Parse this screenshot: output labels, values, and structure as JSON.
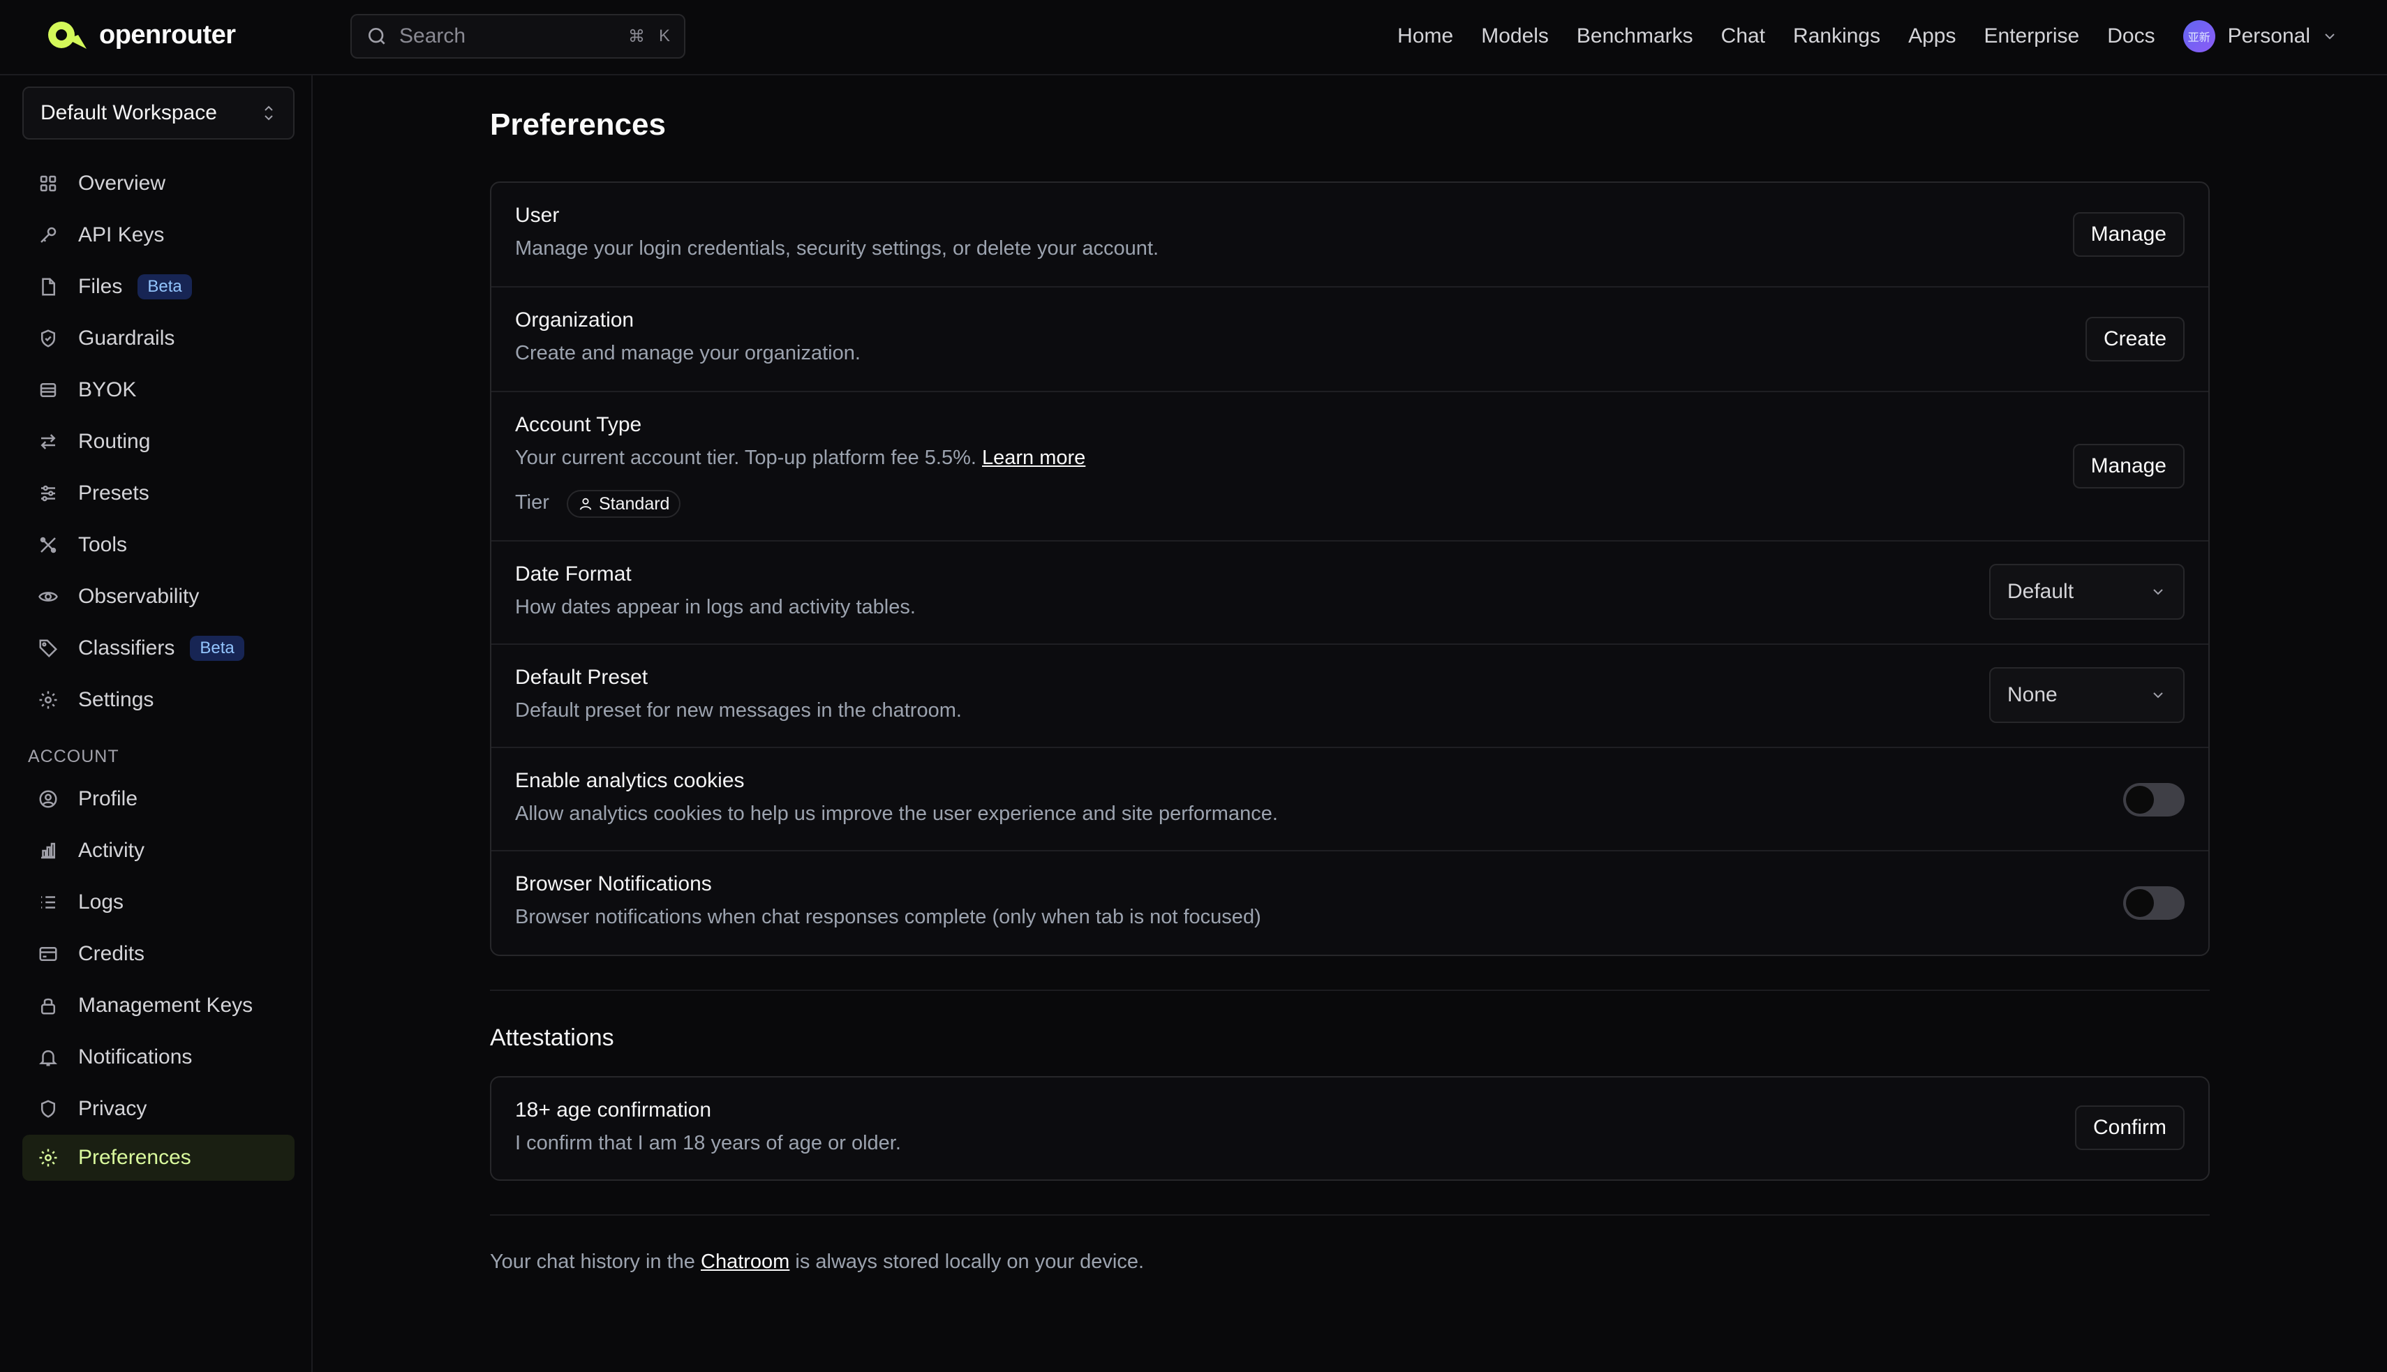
{
  "brand": {
    "name": "openrouter",
    "accent": "#d4f85a"
  },
  "search": {
    "placeholder": "Search",
    "shortcut_mod": "⌘",
    "shortcut_key": "K"
  },
  "nav": {
    "items": [
      "Home",
      "Models",
      "Benchmarks",
      "Chat",
      "Rankings",
      "Apps",
      "Enterprise",
      "Docs"
    ],
    "account_label": "Personal",
    "avatar_text": "亚新"
  },
  "sidebar": {
    "workspace": "Default Workspace",
    "items": [
      {
        "label": "Overview",
        "icon": "grid-icon"
      },
      {
        "label": "API Keys",
        "icon": "key-icon"
      },
      {
        "label": "Files",
        "icon": "file-icon",
        "badge": "Beta"
      },
      {
        "label": "Guardrails",
        "icon": "shield-check-icon"
      },
      {
        "label": "BYOK",
        "icon": "database-icon"
      },
      {
        "label": "Routing",
        "icon": "arrows-icon"
      },
      {
        "label": "Presets",
        "icon": "sliders-icon"
      },
      {
        "label": "Tools",
        "icon": "tools-icon"
      },
      {
        "label": "Observability",
        "icon": "eye-icon"
      },
      {
        "label": "Classifiers",
        "icon": "tag-icon",
        "badge": "Beta"
      },
      {
        "label": "Settings",
        "icon": "gear-icon"
      }
    ],
    "account_section": "ACCOUNT",
    "account_items": [
      {
        "label": "Profile",
        "icon": "user-circle-icon"
      },
      {
        "label": "Activity",
        "icon": "bar-chart-icon"
      },
      {
        "label": "Logs",
        "icon": "list-icon"
      },
      {
        "label": "Credits",
        "icon": "credit-card-icon"
      },
      {
        "label": "Management Keys",
        "icon": "lock-icon"
      },
      {
        "label": "Notifications",
        "icon": "bell-icon"
      },
      {
        "label": "Privacy",
        "icon": "shield-icon"
      },
      {
        "label": "Preferences",
        "icon": "gear-icon",
        "active": true
      }
    ]
  },
  "page": {
    "title": "Preferences",
    "rows": [
      {
        "title": "User",
        "desc": "Manage your login credentials, security settings, or delete your account.",
        "action": "Manage"
      },
      {
        "title": "Organization",
        "desc": "Create and manage your organization.",
        "action": "Create"
      },
      {
        "title": "Account Type",
        "desc": "Your current account tier. Top-up platform fee 5.5%.",
        "link": "Learn more",
        "tier_label": "Tier",
        "tier_value": "Standard",
        "action": "Manage"
      },
      {
        "title": "Date Format",
        "desc": "How dates appear in logs and activity tables.",
        "select": "Default"
      },
      {
        "title": "Default Preset",
        "desc": "Default preset for new messages in the chatroom.",
        "select": "None"
      },
      {
        "title": "Enable analytics cookies",
        "desc": "Allow analytics cookies to help us improve the user experience and site performance.",
        "toggle": false
      },
      {
        "title": "Browser Notifications",
        "desc": "Browser notifications when chat responses complete (only when tab is not focused)",
        "toggle": false
      }
    ],
    "attestations": {
      "title": "Attestations",
      "row": {
        "title": "18+ age confirmation",
        "desc": "I confirm that I am 18 years of age or older.",
        "action": "Confirm"
      }
    },
    "footer": {
      "before": "Your chat history in the",
      "link": "Chatroom",
      "after": "is always stored locally on your device."
    }
  }
}
